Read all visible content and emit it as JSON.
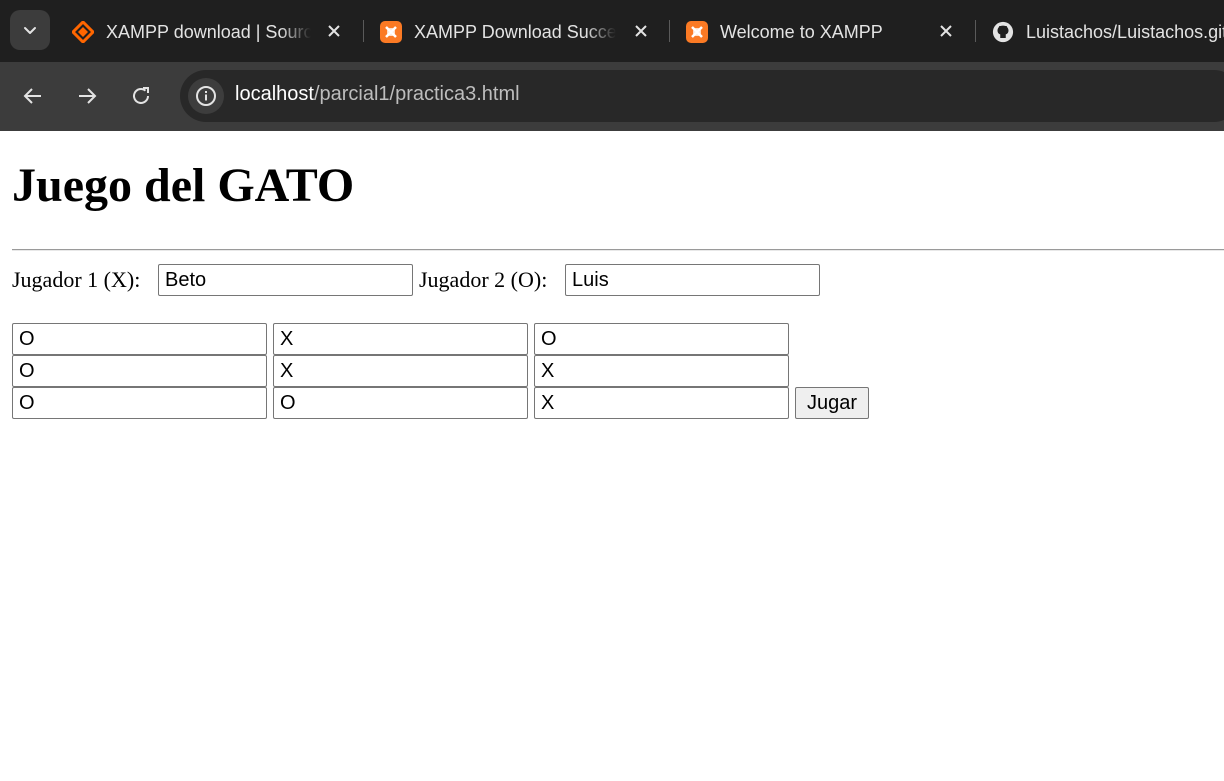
{
  "browser": {
    "tabs": [
      {
        "title": "XAMPP download | SourceForge.net",
        "icon": "sourceforge-icon",
        "active": false
      },
      {
        "title": "XAMPP Download Success",
        "icon": "xampp-icon",
        "active": false
      },
      {
        "title": "Welcome to XAMPP",
        "icon": "xampp-icon",
        "active": false
      },
      {
        "title": "Luistachos/Luistachos.github.io",
        "icon": "github-icon",
        "active": true
      }
    ],
    "url_host": "localhost",
    "url_path": "/parcial1/practica3.html",
    "colors": {
      "xampp_orange": "#fb7a24",
      "sourceforge_orange": "#ff6600",
      "chrome_dark": "#1f1f1f",
      "toolbar": "#3c3c3c"
    }
  },
  "page": {
    "title": "Juego del GATO",
    "player1_label": "Jugador 1 (X):",
    "player1_value": "Beto",
    "player2_label": "Jugador 2 (O):",
    "player2_value": "Luis",
    "board": [
      [
        "O",
        "X",
        "O"
      ],
      [
        "O",
        "X",
        "X"
      ],
      [
        "O",
        "O",
        "X"
      ]
    ],
    "play_button": "Jugar"
  }
}
